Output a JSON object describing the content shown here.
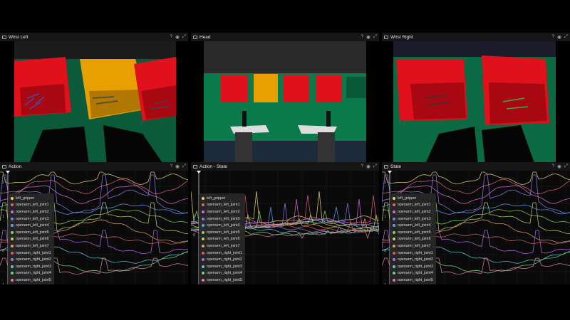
{
  "panels": {
    "wrist_left": {
      "title": "Wrist Left"
    },
    "head": {
      "title": "Head"
    },
    "wrist_right": {
      "title": "Wrist Right"
    },
    "action": {
      "title": "Action"
    },
    "action_state": {
      "title": "Action - State"
    },
    "state": {
      "title": "State"
    }
  },
  "header_icons": {
    "help": "?",
    "visibility": "◉",
    "expand": "⤢"
  },
  "y_ticks": [
    "2",
    "1",
    "0",
    "-1"
  ],
  "legends": {
    "action": [
      "left_gripper",
      "openarm_left_joint1",
      "openarm_left_joint2",
      "openarm_left_joint3",
      "openarm_left_joint4",
      "openarm_left_joint5",
      "openarm_left_joint6",
      "openarm_left_joint7",
      "openarm_right_joint1",
      "openarm_right_joint2",
      "openarm_right_joint3",
      "openarm_right_joint4",
      "openarm_right_joint5"
    ],
    "action_state": [
      "left_gripper",
      "openarm_left_joint1",
      "openarm_left_joint2",
      "openarm_left_joint3",
      "openarm_left_joint4",
      "openarm_left_joint5",
      "openarm_left_joint6",
      "openarm_left_joint7",
      "openarm_right_joint1",
      "openarm_right_joint2",
      "openarm_right_joint3",
      "openarm_right_joint4",
      "openarm_right_joint5"
    ],
    "state": [
      "left_gripper",
      "openarm_left_joint1",
      "openarm_left_joint2",
      "openarm_left_joint3",
      "openarm_left_joint4",
      "openarm_left_joint5",
      "openarm_left_joint6",
      "openarm_left_joint7",
      "openarm_right_joint1",
      "openarm_right_joint2",
      "openarm_right_joint3",
      "openarm_right_joint4",
      "openarm_right_joint5"
    ]
  },
  "series_colors": [
    "#e5d36a",
    "#e06080",
    "#d46ad4",
    "#8a7cf0",
    "#5aa0f0",
    "#8ad060",
    "#c0d060",
    "#e0a060",
    "#d86060",
    "#b070e0",
    "#60c8d0",
    "#70d080",
    "#e080a0"
  ],
  "colors": {
    "bin_red": "#e0101c",
    "bin_yellow": "#e8a000",
    "floor_green": "#0a7a4a",
    "header_bg": "#161616"
  }
}
